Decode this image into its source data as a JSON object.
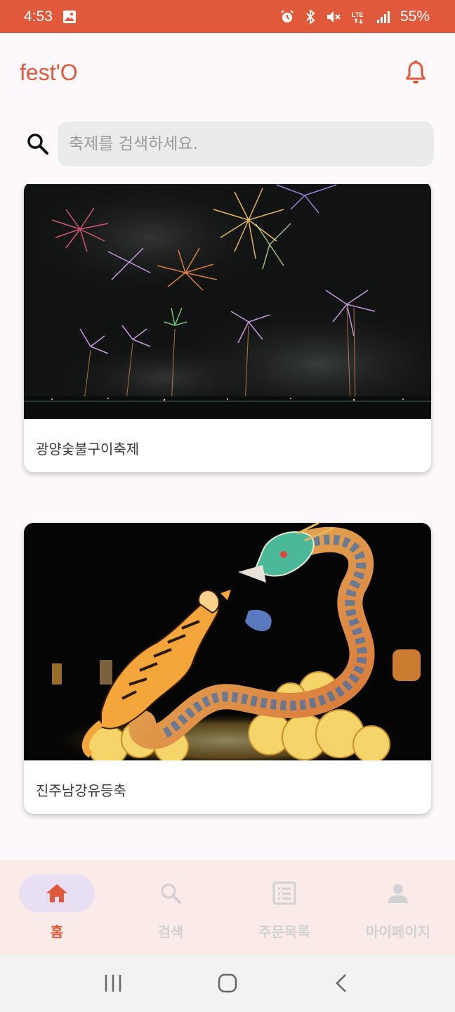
{
  "status_bar": {
    "time": "4:53",
    "battery": "55%",
    "icons": [
      "gallery-icon",
      "alarm-icon",
      "bluetooth-icon",
      "mute-icon",
      "lte-icon",
      "signal-icon"
    ]
  },
  "header": {
    "logo": "fest'O",
    "notification_icon": "bell-icon"
  },
  "search": {
    "placeholder": "축제를 검색하세요."
  },
  "festivals": [
    {
      "title": "광양숯불구이축제",
      "image": "fireworks-night"
    },
    {
      "title": "진주남강유등축",
      "image": "dragon-tiger-lanterns"
    }
  ],
  "bottom_nav": {
    "items": [
      {
        "label": "홈",
        "icon": "home-icon",
        "active": true
      },
      {
        "label": "검색",
        "icon": "search-icon",
        "active": false
      },
      {
        "label": "주문목록",
        "icon": "list-icon",
        "active": false
      },
      {
        "label": "마이페이지",
        "icon": "person-icon",
        "active": false
      }
    ]
  },
  "colors": {
    "primary": "#e0593a",
    "nav_background": "#fbebe8",
    "active_pill": "#e8dff3",
    "inactive": "#d2d2d2"
  }
}
